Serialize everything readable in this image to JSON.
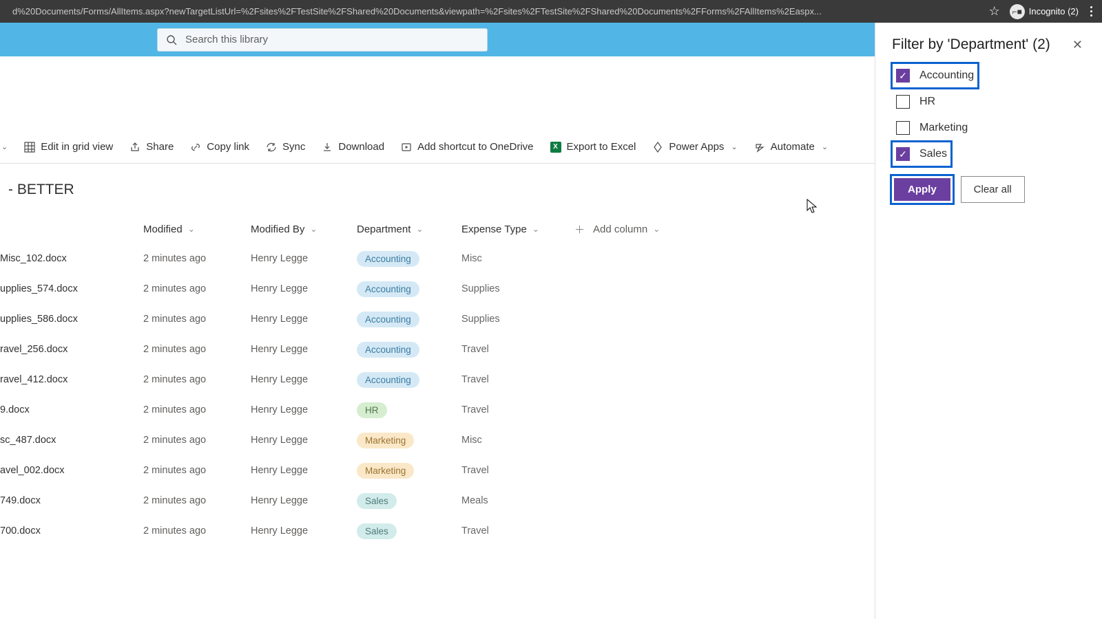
{
  "browser": {
    "url": "d%20Documents/Forms/AllItems.aspx?newTargetListUrl=%2Fsites%2FTestSite%2FShared%20Documents&viewpath=%2Fsites%2FTestSite%2FShared%20Documents%2FForms%2FAllItems%2Easpx...",
    "incognito_label": "Incognito (2)"
  },
  "search": {
    "placeholder": "Search this library"
  },
  "toolbar": {
    "edit_grid": "Edit in grid view",
    "share": "Share",
    "copy_link": "Copy link",
    "sync": "Sync",
    "download": "Download",
    "add_shortcut": "Add shortcut to OneDrive",
    "export_excel": "Export to Excel",
    "power_apps": "Power Apps",
    "automate": "Automate"
  },
  "page_title": "- BETTER",
  "columns": {
    "modified": "Modified",
    "modified_by": "Modified By",
    "department": "Department",
    "expense_type": "Expense Type",
    "add": "Add column"
  },
  "rows": [
    {
      "name": "Misc_102.docx",
      "modified": "2 minutes ago",
      "modified_by": "Henry Legge",
      "dept": "Accounting",
      "exp": "Misc"
    },
    {
      "name": "upplies_574.docx",
      "modified": "2 minutes ago",
      "modified_by": "Henry Legge",
      "dept": "Accounting",
      "exp": "Supplies"
    },
    {
      "name": "upplies_586.docx",
      "modified": "2 minutes ago",
      "modified_by": "Henry Legge",
      "dept": "Accounting",
      "exp": "Supplies"
    },
    {
      "name": "ravel_256.docx",
      "modified": "2 minutes ago",
      "modified_by": "Henry Legge",
      "dept": "Accounting",
      "exp": "Travel"
    },
    {
      "name": "ravel_412.docx",
      "modified": "2 minutes ago",
      "modified_by": "Henry Legge",
      "dept": "Accounting",
      "exp": "Travel"
    },
    {
      "name": "9.docx",
      "modified": "2 minutes ago",
      "modified_by": "Henry Legge",
      "dept": "HR",
      "exp": "Travel"
    },
    {
      "name": "sc_487.docx",
      "modified": "2 minutes ago",
      "modified_by": "Henry Legge",
      "dept": "Marketing",
      "exp": "Misc"
    },
    {
      "name": "avel_002.docx",
      "modified": "2 minutes ago",
      "modified_by": "Henry Legge",
      "dept": "Marketing",
      "exp": "Travel"
    },
    {
      "name": "749.docx",
      "modified": "2 minutes ago",
      "modified_by": "Henry Legge",
      "dept": "Sales",
      "exp": "Meals"
    },
    {
      "name": "700.docx",
      "modified": "2 minutes ago",
      "modified_by": "Henry Legge",
      "dept": "Sales",
      "exp": "Travel"
    }
  ],
  "filter": {
    "title": "Filter by 'Department' (2)",
    "options": [
      {
        "label": "Accounting",
        "checked": true,
        "highlight": true
      },
      {
        "label": "HR",
        "checked": false,
        "highlight": false
      },
      {
        "label": "Marketing",
        "checked": false,
        "highlight": false
      },
      {
        "label": "Sales",
        "checked": true,
        "highlight": true
      }
    ],
    "apply": "Apply",
    "clear": "Clear all"
  }
}
